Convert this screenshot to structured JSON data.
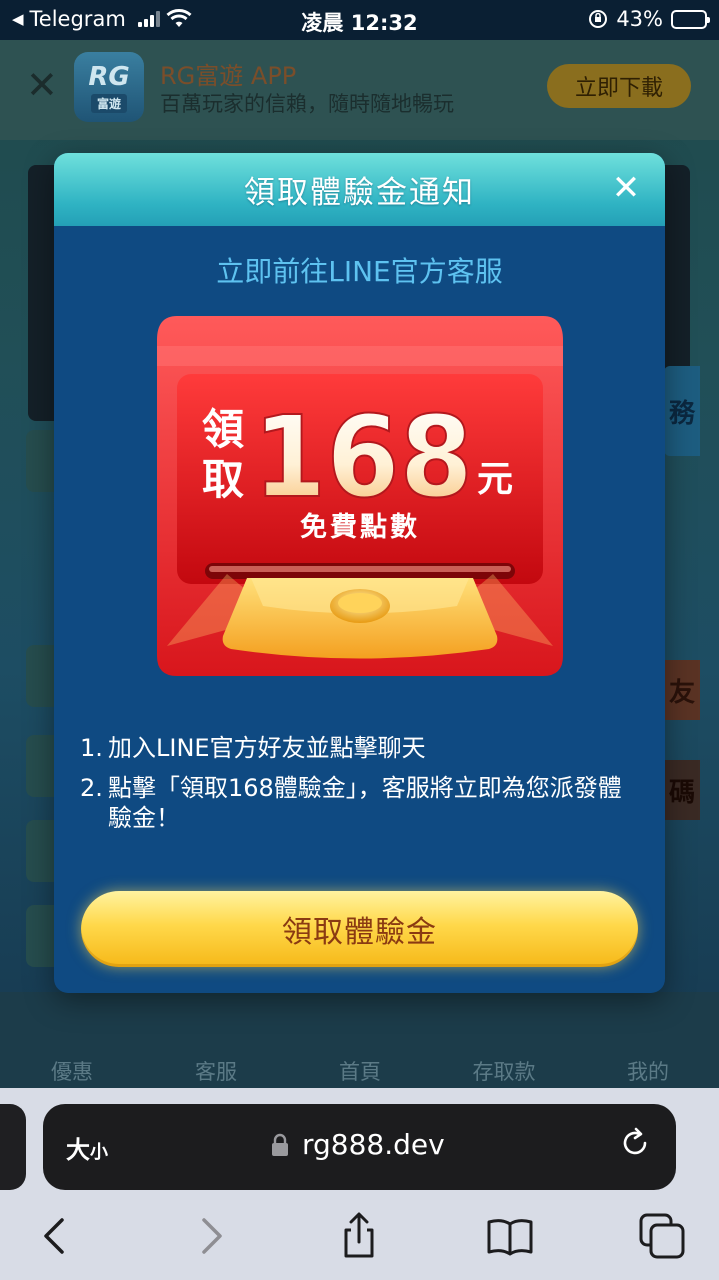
{
  "status_bar": {
    "back_app": "Telegram",
    "time": "凌晨 12:32",
    "battery_percent": "43%",
    "battery_level": 0.43
  },
  "background_page": {
    "banner": {
      "logo_text": "RG",
      "logo_sub": "富遊",
      "title": "RG富遊 APP",
      "subtitle": "百萬玩家的信賴，隨時隨地暢玩",
      "download_label": "立即下載"
    },
    "side_tabs": [
      "務",
      "友",
      "碼"
    ],
    "nav": [
      "優惠",
      "客服",
      "首頁",
      "存取款",
      "我的"
    ]
  },
  "modal": {
    "title": "領取體驗金通知",
    "subtitle": "立即前往LINE官方客服",
    "packet": {
      "claim_top": "領",
      "claim_bottom": "取",
      "amount": "168",
      "unit": "元",
      "caption": "免費點數"
    },
    "instructions": [
      {
        "num": "1.",
        "text": "加入LINE官方好友並點擊聊天"
      },
      {
        "num": "2.",
        "text": "點擊「領取168體驗金」，客服將立即為您派發體驗金！"
      }
    ],
    "cta_label": "領取體驗金",
    "colors": {
      "header": "#2fb3c3",
      "body": "#0f4a82",
      "cta": "#ffd84a"
    }
  },
  "browser": {
    "text_size_label": "大",
    "text_size_small": "小",
    "url": "rg888.dev"
  }
}
